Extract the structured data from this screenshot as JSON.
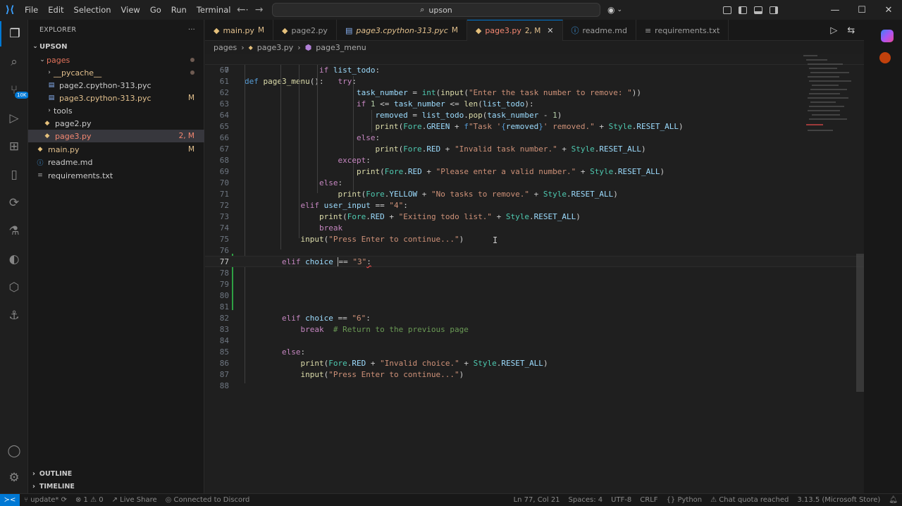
{
  "menu": [
    "File",
    "Edit",
    "Selection",
    "View",
    "Go",
    "Run",
    "Terminal",
    "···"
  ],
  "search": {
    "text": "upson"
  },
  "sidebar": {
    "header": "EXPLORER",
    "root": "UPSON",
    "items": [
      {
        "label": "pages",
        "status": ""
      },
      {
        "label": "__pycache__",
        "status": ""
      },
      {
        "label": "page2.cpython-313.pyc",
        "status": ""
      },
      {
        "label": "page3.cpython-313.pyc",
        "status": "M"
      },
      {
        "label": "tools",
        "status": ""
      },
      {
        "label": "page2.py",
        "status": ""
      },
      {
        "label": "page3.py",
        "status": "2, M"
      },
      {
        "label": "main.py",
        "status": "M"
      },
      {
        "label": "readme.md",
        "status": ""
      },
      {
        "label": "requirements.txt",
        "status": ""
      }
    ],
    "outline": "OUTLINE",
    "timeline": "TIMELINE"
  },
  "tabs": [
    {
      "label": "main.py",
      "status": "M"
    },
    {
      "label": "page2.py",
      "status": ""
    },
    {
      "label": "page3.cpython-313.pyc",
      "status": "M"
    },
    {
      "label": "page3.py",
      "status": "2, M"
    },
    {
      "label": "readme.md",
      "status": ""
    },
    {
      "label": "requirements.txt",
      "status": ""
    }
  ],
  "breadcrumb": [
    "pages",
    "page3.py",
    "page3_menu"
  ],
  "editor": {
    "sticky": {
      "num": "7",
      "text": "def page3_menu():"
    },
    "lines": [
      "60",
      "61",
      "62",
      "63",
      "64",
      "65",
      "66",
      "67",
      "68",
      "69",
      "70",
      "71",
      "72",
      "73",
      "74",
      "75",
      "76",
      "77",
      "78",
      "79",
      "80",
      "81",
      "82",
      "83",
      "84",
      "85",
      "86",
      "87",
      "88"
    ]
  },
  "statusbar": {
    "branch": "update*",
    "problems": "⊗ 1 ⚠ 0",
    "liveshare": "Live Share",
    "discord": "Connected to Discord",
    "position": "Ln 77, Col 21",
    "spaces": "Spaces: 4",
    "encoding": "UTF-8",
    "eol": "CRLF",
    "language": "Python",
    "chat": "Chat quota reached",
    "interpreter": "3.13.5 (Microsoft Store)"
  },
  "colors": {
    "accent": "#0078d4",
    "modified": "#e2c08d",
    "error": "#f48771",
    "added": "#2ea043"
  }
}
